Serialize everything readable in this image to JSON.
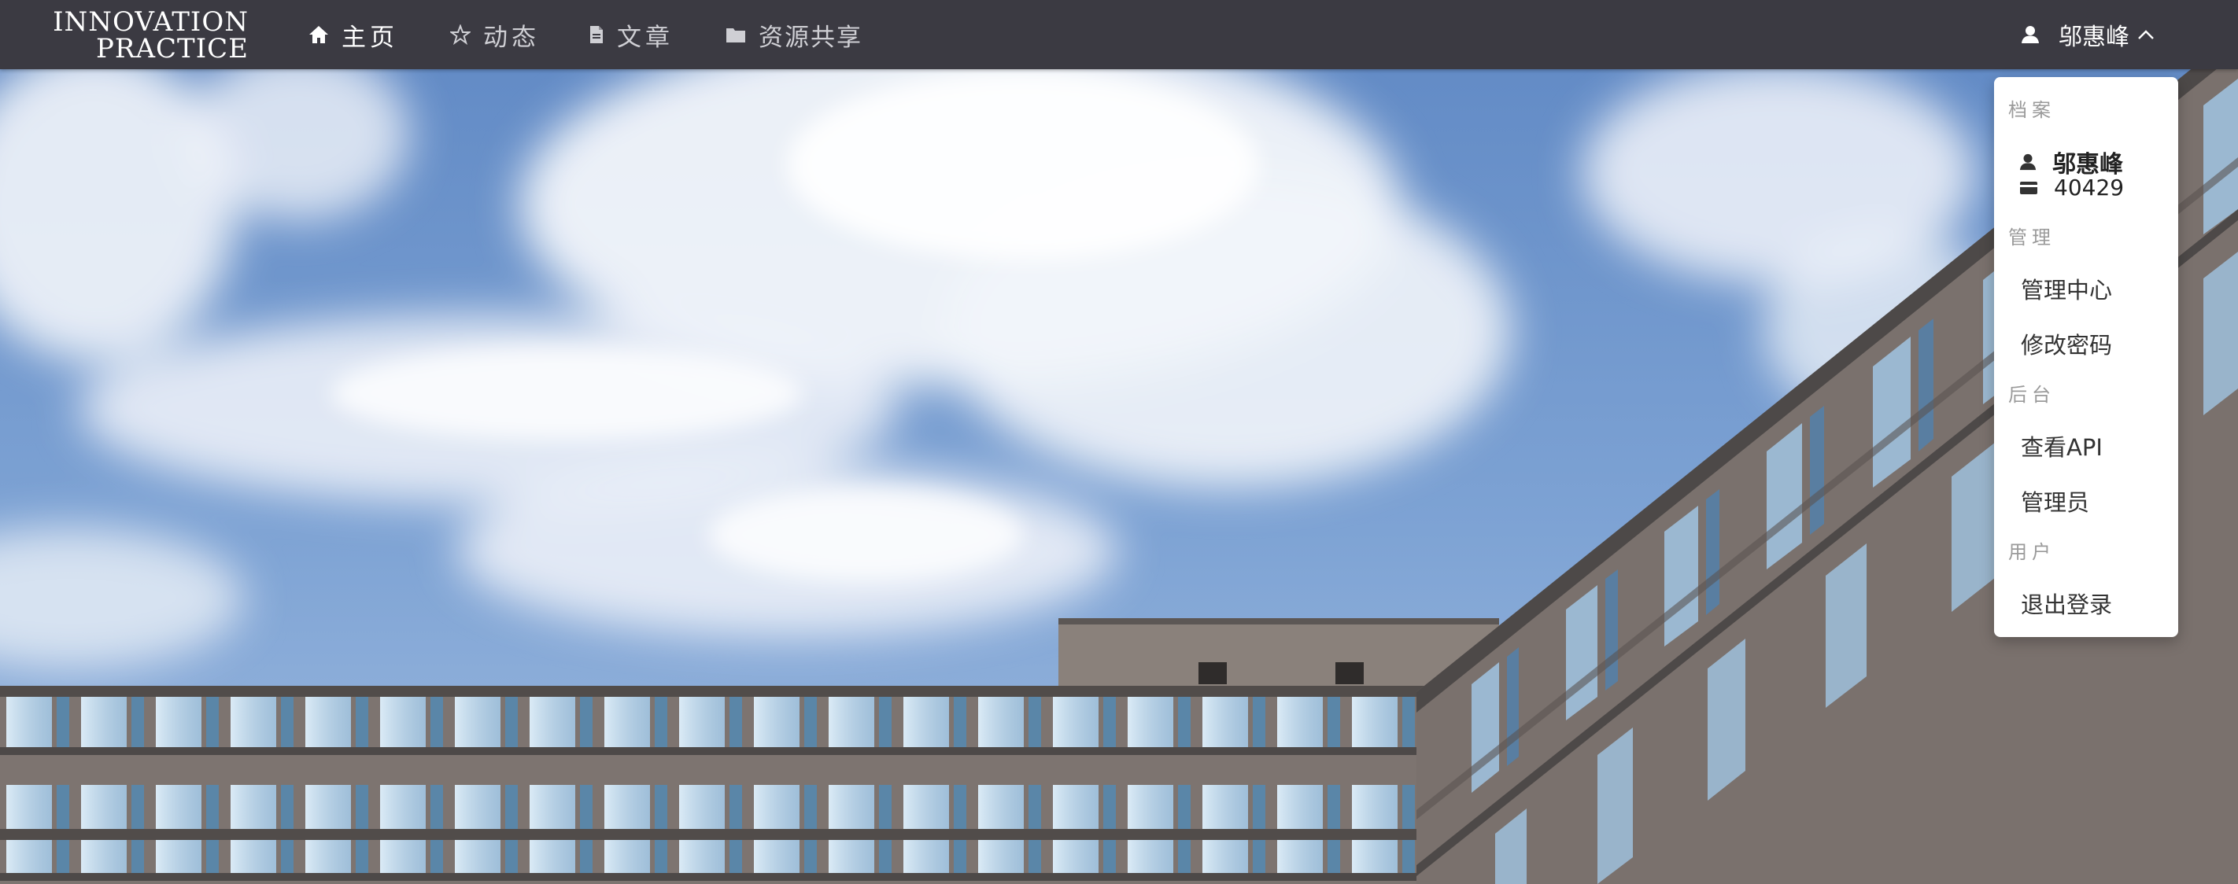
{
  "brand": {
    "line1": "INNOVATION",
    "line2": "PRACTICE"
  },
  "nav": {
    "items": [
      {
        "label": "主页",
        "icon": "home-icon",
        "active": true
      },
      {
        "label": "动态",
        "icon": "star-icon",
        "active": false
      },
      {
        "label": "文章",
        "icon": "file-icon",
        "active": false
      },
      {
        "label": "资源共享",
        "icon": "folder-icon",
        "active": false
      }
    ]
  },
  "user": {
    "name": "邬惠峰",
    "icon": "user-icon",
    "caret": "chevron-up-icon"
  },
  "dropdown": {
    "sections": {
      "profile": {
        "header": "档案",
        "name": "邬惠峰",
        "id": "40429"
      },
      "manage": {
        "header": "管理",
        "items": [
          "管理中心",
          "修改密码"
        ]
      },
      "backend": {
        "header": "后台",
        "items": [
          "查看API",
          "管理员"
        ]
      },
      "user": {
        "header": "用户",
        "items": [
          "退出登录"
        ]
      }
    }
  },
  "colors": {
    "navbar": "#3b3a42",
    "nav_text": "#cfcfd4",
    "nav_active": "#ffffff",
    "dropdown_header": "#9a9a9a"
  }
}
